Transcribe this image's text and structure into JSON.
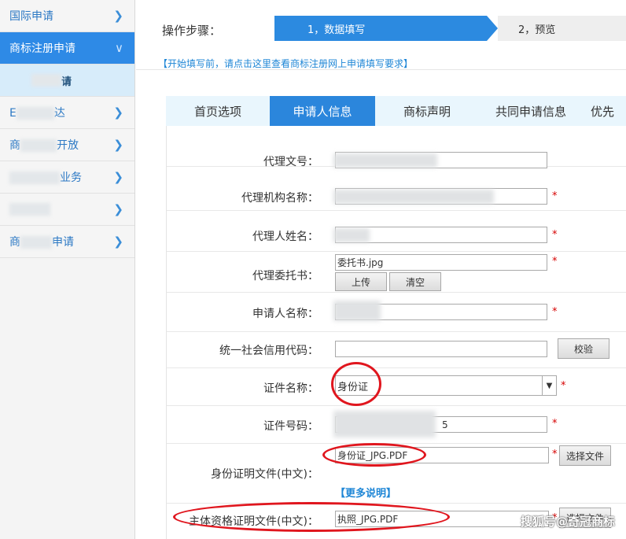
{
  "sidebar": {
    "items": [
      {
        "label": "国际申请",
        "active": false
      },
      {
        "label": "商标注册申请",
        "active": true
      },
      {
        "label": "请",
        "sub": true
      },
      {
        "label": "E",
        "tail": "达",
        "blurred": true
      },
      {
        "label": "商",
        "tail": "开放",
        "blurred": true
      },
      {
        "label": "",
        "tail": "业务",
        "blurred": true
      },
      {
        "label": "",
        "tail": "",
        "blurred": true
      },
      {
        "label": "商",
        "tail": "申请",
        "blurred": true
      }
    ]
  },
  "steps": {
    "label": "操作步骤：",
    "step1": "1，数据填写",
    "step2": "2，预览"
  },
  "hint": "【开始填写前，请点击这里查看商标注册网上申请填写要求】",
  "tabs": [
    "首页选项",
    "申请人信息",
    "商标声明",
    "共同申请信息",
    "优先"
  ],
  "form": {
    "agent_no_label": "代理文号：",
    "agency_name_label": "代理机构名称：",
    "agent_name_label": "代理人姓名：",
    "power_of_attorney_label": "代理委托书：",
    "power_of_attorney_value": "委托书.jpg",
    "upload_label": "上传",
    "clear_label": "清空",
    "applicant_name_label": "申请人名称：",
    "credit_code_label": "统一社会信用代码：",
    "verify_label": "校验",
    "cert_name_label": "证件名称：",
    "cert_name_value": "身份证",
    "cert_no_label": "证件号码：",
    "cert_no_value": "5",
    "id_file_label": "身份证明文件(中文)：",
    "id_file_value": "身份证_JPG.PDF",
    "choose_file_label": "选择文件",
    "more_label": "【更多说明】",
    "subject_file_label": "主体资格证明文件(中文)：",
    "subject_file_value": "执照_JPG.PDF",
    "required_mark": "*"
  },
  "watermark": "搜狐号@奇冠商标",
  "colors": {
    "accent": "#2c8ae0",
    "required": "#d60000",
    "annotation": "#e0161e"
  }
}
